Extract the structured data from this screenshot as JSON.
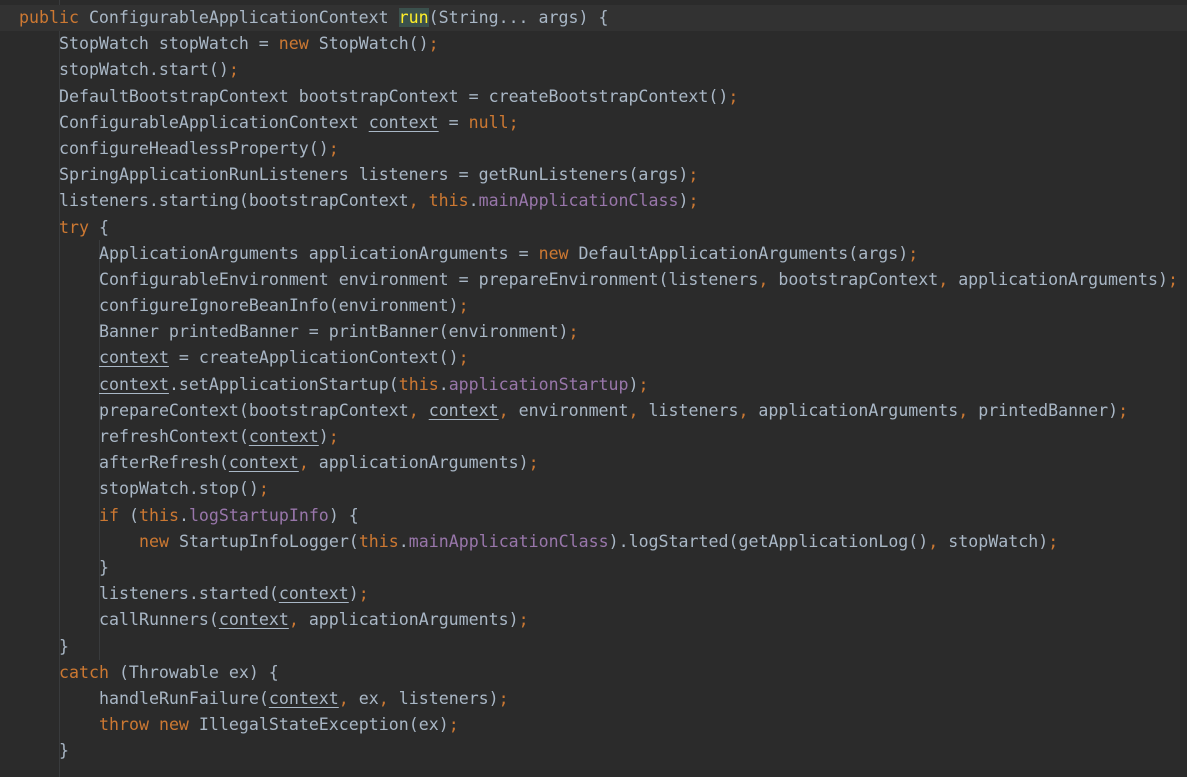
{
  "editor": {
    "colors": {
      "background": "#2b2b2b",
      "current_line": "#323232",
      "text": "#a9b7c6",
      "keyword": "#cc7832",
      "field": "#9876aa",
      "method_declaration": "#ffc66d",
      "indent_guide": "#393b3d"
    },
    "lines": [
      {
        "indent": 0,
        "tokens": [
          {
            "t": "public",
            "c": "kw"
          },
          {
            "t": " ConfigurableApplicationContext "
          },
          {
            "t": "run",
            "c": "fn match"
          },
          {
            "t": "(String... args) {"
          }
        ]
      },
      {
        "indent": 1,
        "tokens": [
          {
            "t": "StopWatch stopWatch = "
          },
          {
            "t": "new",
            "c": "kw"
          },
          {
            "t": " StopWatch()"
          },
          {
            "t": ";",
            "c": "pun"
          }
        ]
      },
      {
        "indent": 1,
        "tokens": [
          {
            "t": "stopWatch.start()"
          },
          {
            "t": ";",
            "c": "pun"
          }
        ]
      },
      {
        "indent": 1,
        "tokens": [
          {
            "t": "DefaultBootstrapContext bootstrapContext = createBootstrapContext()"
          },
          {
            "t": ";",
            "c": "pun"
          }
        ]
      },
      {
        "indent": 1,
        "tokens": [
          {
            "t": "ConfigurableApplicationContext "
          },
          {
            "t": "context",
            "c": "reassigned"
          },
          {
            "t": " = "
          },
          {
            "t": "null",
            "c": "kw"
          },
          {
            "t": ";",
            "c": "pun"
          }
        ]
      },
      {
        "indent": 1,
        "tokens": [
          {
            "t": "configureHeadlessProperty()"
          },
          {
            "t": ";",
            "c": "pun"
          }
        ]
      },
      {
        "indent": 1,
        "tokens": [
          {
            "t": "SpringApplicationRunListeners listeners = getRunListeners(args)"
          },
          {
            "t": ";",
            "c": "pun"
          }
        ]
      },
      {
        "indent": 1,
        "tokens": [
          {
            "t": "listeners.starting(bootstrapContext"
          },
          {
            "t": ",",
            "c": "pun"
          },
          {
            "t": " "
          },
          {
            "t": "this",
            "c": "kw"
          },
          {
            "t": "."
          },
          {
            "t": "mainApplicationClass",
            "c": "fld"
          },
          {
            "t": ")"
          },
          {
            "t": ";",
            "c": "pun"
          }
        ]
      },
      {
        "indent": 1,
        "tokens": [
          {
            "t": "try",
            "c": "kw"
          },
          {
            "t": " {"
          }
        ]
      },
      {
        "indent": 2,
        "tokens": [
          {
            "t": "ApplicationArguments applicationArguments = "
          },
          {
            "t": "new",
            "c": "kw"
          },
          {
            "t": " DefaultApplicationArguments(args)"
          },
          {
            "t": ";",
            "c": "pun"
          }
        ]
      },
      {
        "indent": 2,
        "tokens": [
          {
            "t": "ConfigurableEnvironment environment = prepareEnvironment(listeners"
          },
          {
            "t": ",",
            "c": "pun"
          },
          {
            "t": " bootstrapContext"
          },
          {
            "t": ",",
            "c": "pun"
          },
          {
            "t": " applicationArguments)"
          },
          {
            "t": ";",
            "c": "pun"
          }
        ]
      },
      {
        "indent": 2,
        "tokens": [
          {
            "t": "configureIgnoreBeanInfo(environment)"
          },
          {
            "t": ";",
            "c": "pun"
          }
        ]
      },
      {
        "indent": 2,
        "tokens": [
          {
            "t": "Banner printedBanner = printBanner(environment)"
          },
          {
            "t": ";",
            "c": "pun"
          }
        ]
      },
      {
        "indent": 2,
        "tokens": [
          {
            "t": "context",
            "c": "reassigned"
          },
          {
            "t": " = createApplicationContext()"
          },
          {
            "t": ";",
            "c": "pun"
          }
        ]
      },
      {
        "indent": 2,
        "tokens": [
          {
            "t": "context",
            "c": "reassigned"
          },
          {
            "t": ".setApplicationStartup("
          },
          {
            "t": "this",
            "c": "kw"
          },
          {
            "t": "."
          },
          {
            "t": "applicationStartup",
            "c": "fld"
          },
          {
            "t": ")"
          },
          {
            "t": ";",
            "c": "pun"
          }
        ]
      },
      {
        "indent": 2,
        "tokens": [
          {
            "t": "prepareContext(bootstrapContext"
          },
          {
            "t": ",",
            "c": "pun"
          },
          {
            "t": " "
          },
          {
            "t": "context",
            "c": "reassigned"
          },
          {
            "t": ",",
            "c": "pun"
          },
          {
            "t": " environment"
          },
          {
            "t": ",",
            "c": "pun"
          },
          {
            "t": " listeners"
          },
          {
            "t": ",",
            "c": "pun"
          },
          {
            "t": " applicationArguments"
          },
          {
            "t": ",",
            "c": "pun"
          },
          {
            "t": " printedBanner)"
          },
          {
            "t": ";",
            "c": "pun"
          }
        ]
      },
      {
        "indent": 2,
        "tokens": [
          {
            "t": "refreshContext("
          },
          {
            "t": "context",
            "c": "reassigned"
          },
          {
            "t": ")"
          },
          {
            "t": ";",
            "c": "pun"
          }
        ]
      },
      {
        "indent": 2,
        "tokens": [
          {
            "t": "afterRefresh("
          },
          {
            "t": "context",
            "c": "reassigned"
          },
          {
            "t": ",",
            "c": "pun"
          },
          {
            "t": " applicationArguments)"
          },
          {
            "t": ";",
            "c": "pun"
          }
        ]
      },
      {
        "indent": 2,
        "tokens": [
          {
            "t": "stopWatch.stop()"
          },
          {
            "t": ";",
            "c": "pun"
          }
        ]
      },
      {
        "indent": 2,
        "tokens": [
          {
            "t": "if",
            "c": "kw"
          },
          {
            "t": " ("
          },
          {
            "t": "this",
            "c": "kw"
          },
          {
            "t": "."
          },
          {
            "t": "logStartupInfo",
            "c": "fld"
          },
          {
            "t": ") {"
          }
        ]
      },
      {
        "indent": 3,
        "tokens": [
          {
            "t": "new",
            "c": "kw"
          },
          {
            "t": " StartupInfoLogger("
          },
          {
            "t": "this",
            "c": "kw"
          },
          {
            "t": "."
          },
          {
            "t": "mainApplicationClass",
            "c": "fld"
          },
          {
            "t": ").logStarted(getApplicationLog()"
          },
          {
            "t": ",",
            "c": "pun"
          },
          {
            "t": " stopWatch)"
          },
          {
            "t": ";",
            "c": "pun"
          }
        ]
      },
      {
        "indent": 2,
        "tokens": [
          {
            "t": "}"
          }
        ]
      },
      {
        "indent": 2,
        "tokens": [
          {
            "t": "listeners.started("
          },
          {
            "t": "context",
            "c": "reassigned"
          },
          {
            "t": ")"
          },
          {
            "t": ";",
            "c": "pun"
          }
        ]
      },
      {
        "indent": 2,
        "tokens": [
          {
            "t": "callRunners("
          },
          {
            "t": "context",
            "c": "reassigned"
          },
          {
            "t": ",",
            "c": "pun"
          },
          {
            "t": " applicationArguments)"
          },
          {
            "t": ";",
            "c": "pun"
          }
        ]
      },
      {
        "indent": 1,
        "tokens": [
          {
            "t": "}"
          }
        ]
      },
      {
        "indent": 1,
        "tokens": [
          {
            "t": "catch",
            "c": "kw"
          },
          {
            "t": " (Throwable ex) {"
          }
        ]
      },
      {
        "indent": 2,
        "tokens": [
          {
            "t": "handleRunFailure("
          },
          {
            "t": "context",
            "c": "reassigned"
          },
          {
            "t": ",",
            "c": "pun"
          },
          {
            "t": " ex"
          },
          {
            "t": ",",
            "c": "pun"
          },
          {
            "t": " listeners)"
          },
          {
            "t": ";",
            "c": "pun"
          }
        ]
      },
      {
        "indent": 2,
        "tokens": [
          {
            "t": "throw",
            "c": "kw"
          },
          {
            "t": " "
          },
          {
            "t": "new",
            "c": "kw"
          },
          {
            "t": " IllegalStateException(ex)"
          },
          {
            "t": ";",
            "c": "pun"
          }
        ]
      },
      {
        "indent": 1,
        "tokens": [
          {
            "t": "}"
          }
        ]
      }
    ]
  }
}
